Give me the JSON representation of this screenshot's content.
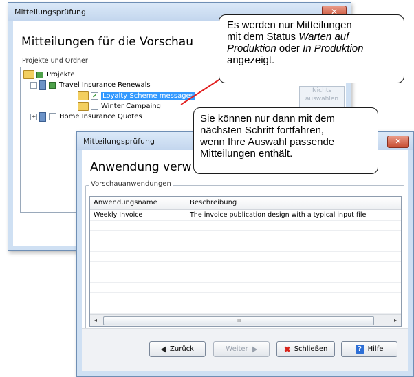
{
  "back_window": {
    "title": "Mitteilungsprüfung",
    "close_glyph": "✕",
    "heading": "Mitteilungen für die Vorschau",
    "subheading": "Projekte und Ordner",
    "tree": {
      "root": "Projekte",
      "project1": "Travel Insurance Renewals",
      "item1": "Loyalty Scheme messages",
      "item2": "Winter Campaing",
      "project2": "Home Insurance Quotes"
    },
    "side_button_label": "Nichts auswählen"
  },
  "callouts": {
    "top": {
      "line1": "Es werden nur Mitteilungen",
      "line2_prefix": "mit dem Status ",
      "line2_em": "Warten auf",
      "line3_em1": "Produktion",
      "line3_mid": " oder ",
      "line3_em2": "In Produktion",
      "line4": "angezeigt."
    },
    "mid": {
      "line1": "Sie können nur dann mit dem",
      "line2": "nächsten Schritt fortfahren,",
      "line3": "wenn Ihre Auswahl passende",
      "line4": "Mitteilungen enthält."
    }
  },
  "front_window": {
    "title": "Mitteilungsprüfung",
    "close_glyph": "✕",
    "heading": "Anwendung verw",
    "group_label": "Vorschauanwendungen",
    "columns": [
      "Anwendungsname",
      "Beschreibung"
    ],
    "rows": [
      {
        "name": "Weekly Invoice",
        "description": "The invoice publication design with a typical input file"
      }
    ],
    "scroll": {
      "left": "◂",
      "right": "▸",
      "thumb_grip": "III"
    },
    "buttons": {
      "back": "Zurück",
      "next": "Weiter",
      "close": "Schließen",
      "help": "Hilfe"
    },
    "close_icon_glyph": "✖",
    "help_icon_glyph": "?"
  }
}
